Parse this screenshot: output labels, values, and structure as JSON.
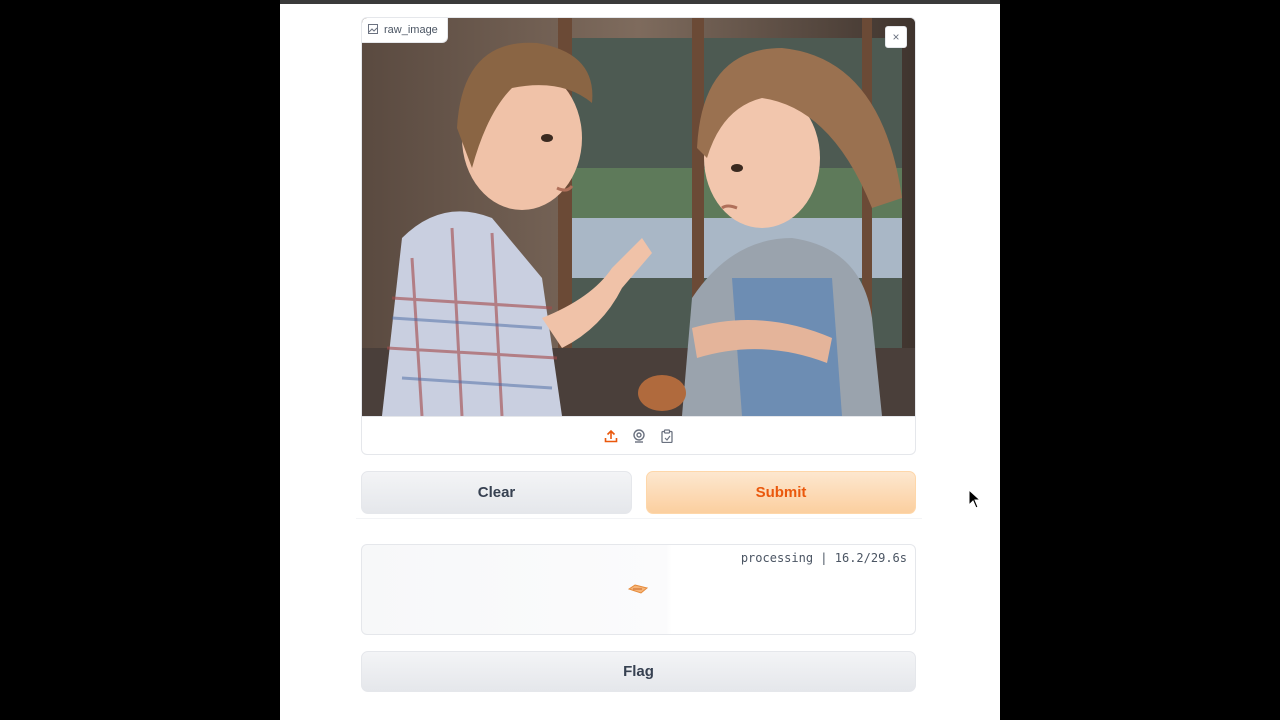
{
  "image_input": {
    "label": "raw_image",
    "close_symbol": "×",
    "sources": [
      "upload-icon",
      "webcam-icon",
      "clipboard-icon"
    ]
  },
  "buttons": {
    "clear_label": "Clear",
    "submit_label": "Submit",
    "flag_label": "Flag"
  },
  "output": {
    "status_text": "processing | 16.2/29.6s"
  },
  "colors": {
    "accent": "#ea580c",
    "submit_bg": "#fbcf9f",
    "neutral_bg": "#e5e7eb"
  }
}
